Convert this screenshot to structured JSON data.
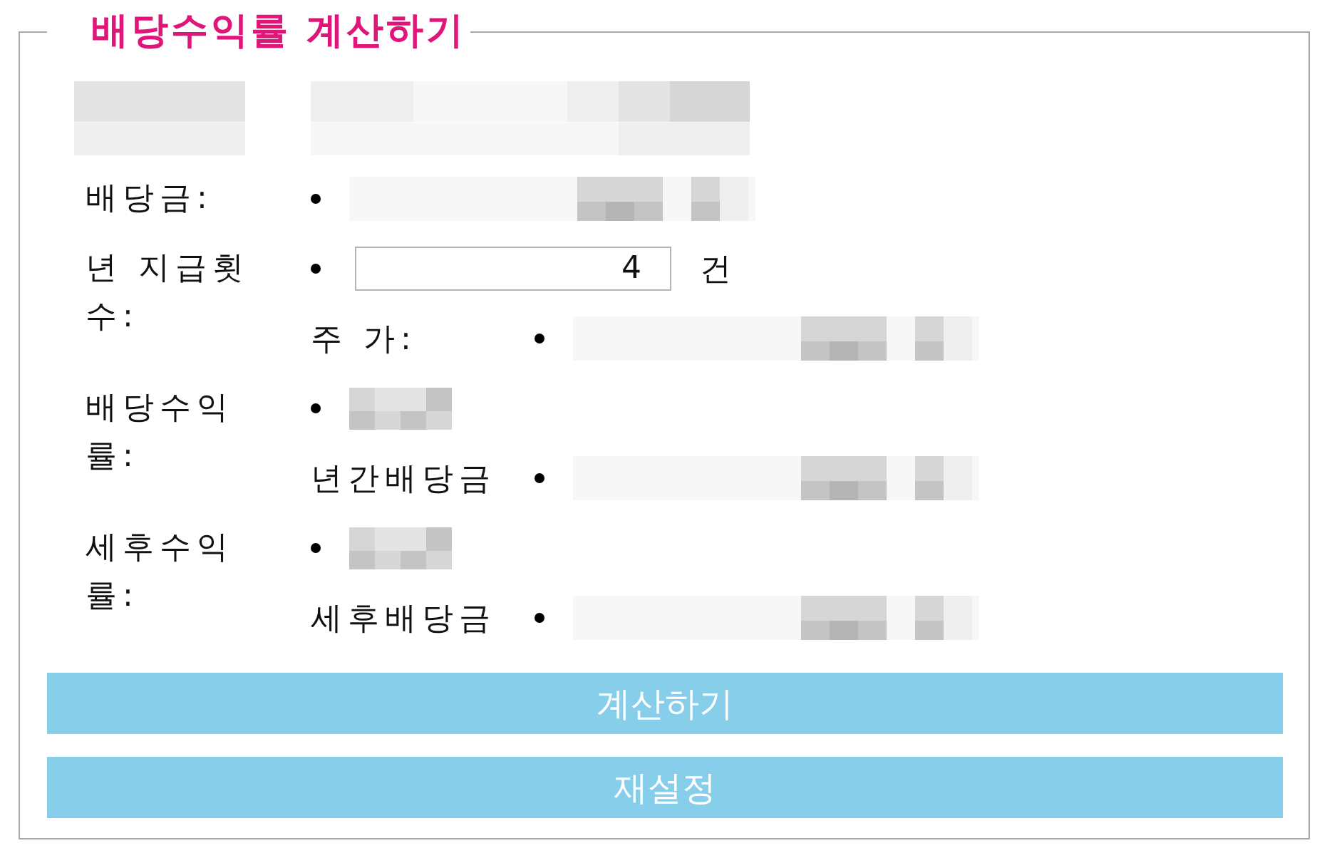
{
  "form": {
    "title": "배당수익률 계산하기",
    "rows": [
      {
        "label": {
          "kind": "masked"
        },
        "lines": [
          {
            "bullet": false,
            "value": {
              "kind": "masked_heading"
            }
          }
        ]
      },
      {
        "label": {
          "kind": "text",
          "text": "배당금:"
        },
        "lines": [
          {
            "bullet": true,
            "value": {
              "kind": "masked_amount"
            }
          }
        ]
      },
      {
        "label": {
          "kind": "text",
          "text": "년 지급횟수:"
        },
        "lines": [
          {
            "bullet": true,
            "value": {
              "kind": "input",
              "value": "4",
              "unit": "건"
            }
          },
          {
            "sublabel": "주 가:",
            "bullet": true,
            "value": {
              "kind": "masked_amount"
            }
          }
        ]
      },
      {
        "label": {
          "kind": "text",
          "text": "배당수익률:"
        },
        "lines": [
          {
            "bullet": true,
            "value": {
              "kind": "masked_rate"
            }
          },
          {
            "sublabel": "년간배당금",
            "bullet": true,
            "value": {
              "kind": "masked_amount"
            }
          }
        ]
      },
      {
        "label": {
          "kind": "text",
          "text": "세후수익률:"
        },
        "lines": [
          {
            "bullet": true,
            "value": {
              "kind": "masked_rate"
            }
          },
          {
            "sublabel": "세후배당금",
            "bullet": true,
            "value": {
              "kind": "masked_amount"
            }
          }
        ]
      }
    ],
    "buttons": {
      "calculate": "계산하기",
      "reset": "재설정"
    }
  }
}
